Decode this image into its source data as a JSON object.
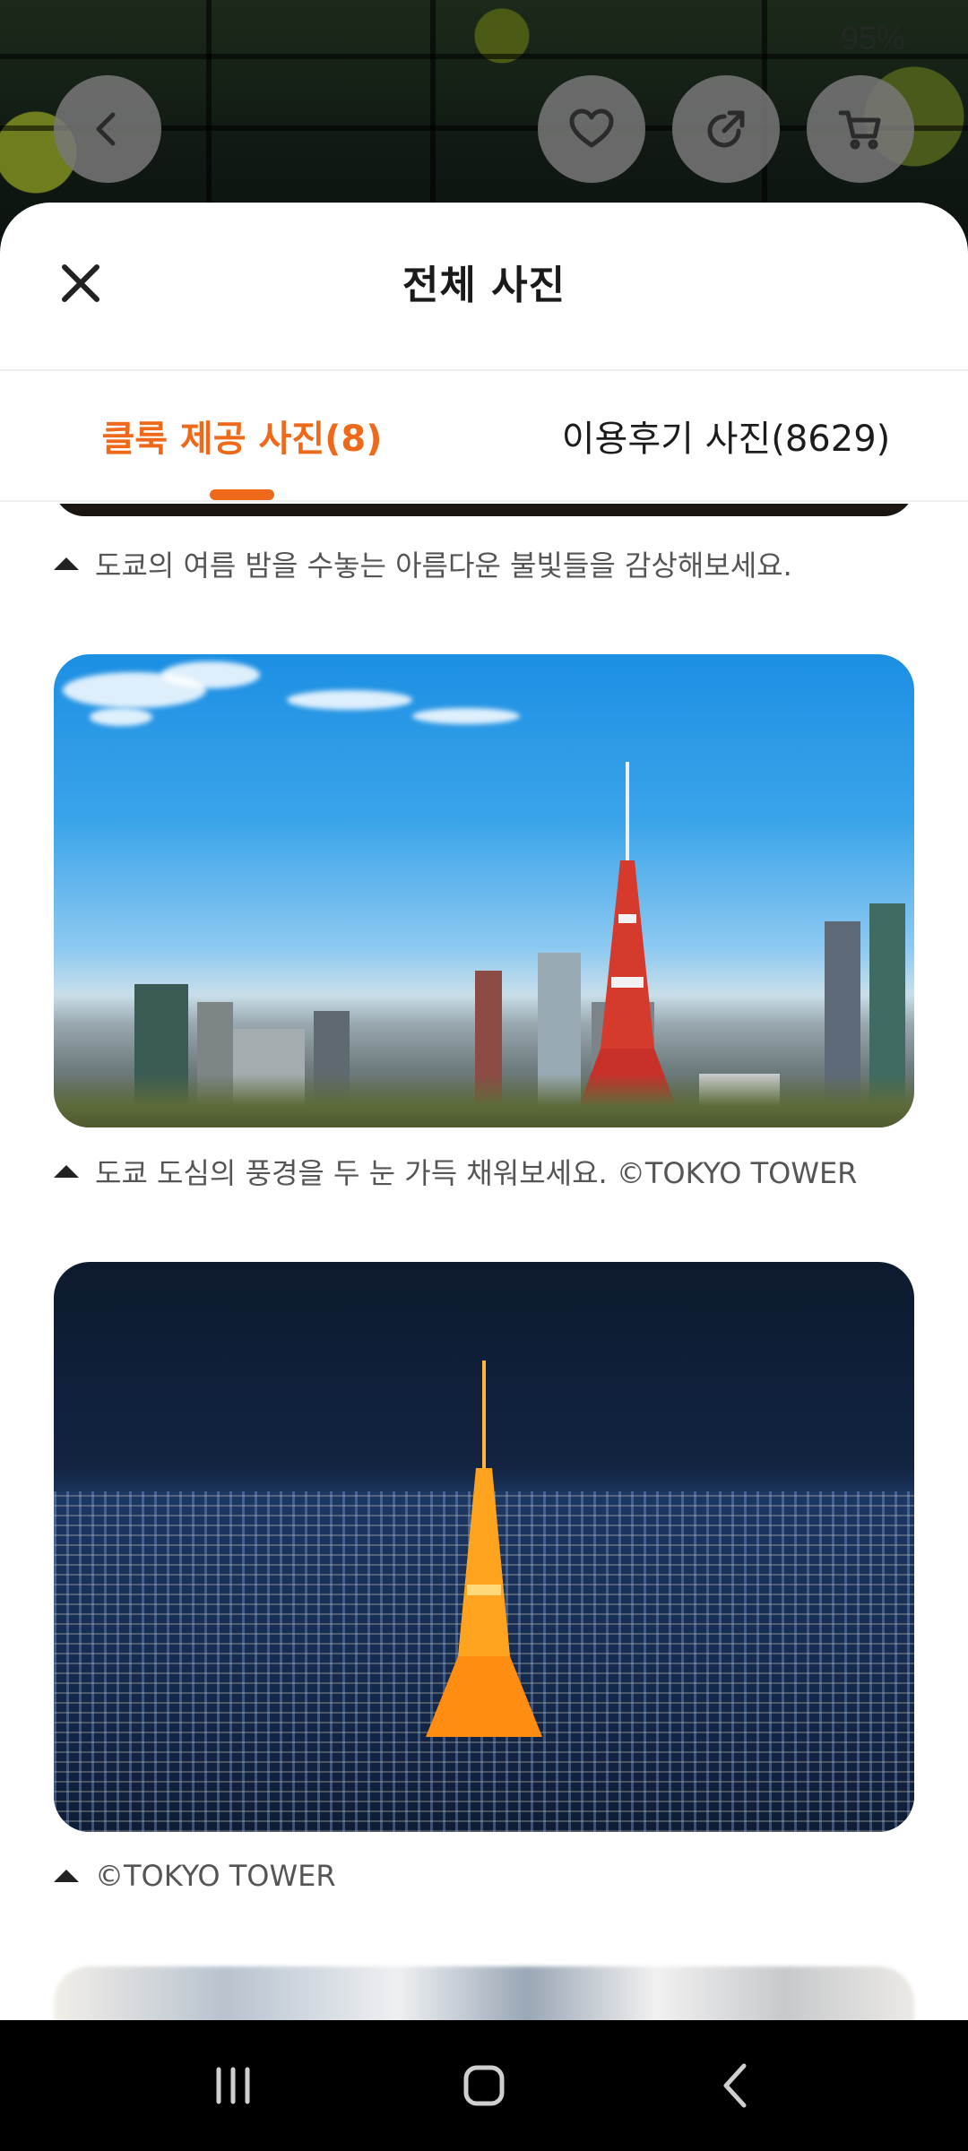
{
  "status_bar": {
    "battery": "95%"
  },
  "top_actions": [
    {
      "name": "back",
      "icon": "chevron-left-icon"
    },
    {
      "name": "wishlist",
      "icon": "heart-icon"
    },
    {
      "name": "share",
      "icon": "share-icon"
    },
    {
      "name": "cart",
      "icon": "cart-icon"
    }
  ],
  "sheet": {
    "title": "전체 사진",
    "close_icon": "close-icon"
  },
  "tabs": [
    {
      "label": "클룩 제공 사진(8)",
      "active": true
    },
    {
      "label": "이용후기 사진(8629)",
      "active": false
    }
  ],
  "photos": [
    {
      "caption": "도쿄의 여름 밤을 수놓는 아름다운 불빛들을 감상해보세요."
    },
    {
      "caption": "도쿄 도심의 풍경을 두 눈 가득 채워보세요. ©TOKYO TOWER"
    },
    {
      "caption": "©TOKYO TOWER"
    }
  ],
  "colors": {
    "accent": "#ee6a1a",
    "sheet_bg": "#ffffff",
    "nav_bg": "#000000"
  },
  "navbar": {
    "icons": [
      "recent-apps-icon",
      "home-icon",
      "back-icon"
    ]
  }
}
